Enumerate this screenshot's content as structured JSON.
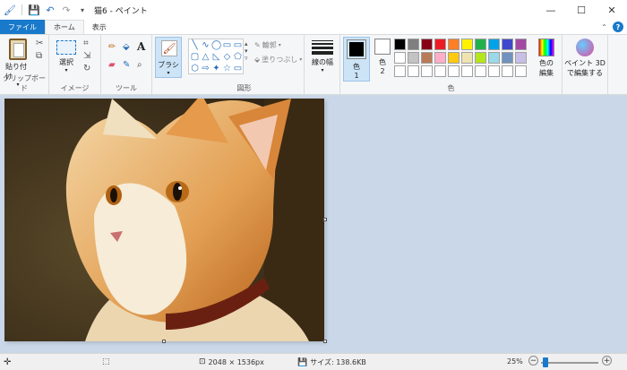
{
  "window": {
    "title": "猫6 - ペイント",
    "minimize_glyph": "—",
    "maximize_glyph": "☐",
    "close_glyph": "✕"
  },
  "menu": {
    "file": "ファイル",
    "home": "ホーム",
    "view": "表示",
    "help_glyph": "?"
  },
  "ribbon": {
    "clipboard": {
      "paste_label": "貼り付け",
      "group_label": "クリップボード"
    },
    "image": {
      "select_label": "選択",
      "group_label": "イメージ"
    },
    "tools": {
      "group_label": "ツール"
    },
    "brushes": {
      "label": "ブラシ"
    },
    "shapes": {
      "outline_label": "輪郭",
      "fill_label": "塗りつぶし",
      "group_label": "図形",
      "glyphs": [
        "╲",
        "∿",
        "◯",
        "▭",
        "▭",
        "▢",
        "△",
        "◺",
        "◇",
        "⬠",
        "⬡",
        "⇨",
        "✦",
        "☆",
        "▭"
      ]
    },
    "size": {
      "label": "線の幅"
    },
    "colors": {
      "color1_label": "色",
      "color1_num": "1",
      "color2_label": "色",
      "color2_num": "2",
      "color1_value": "#000000",
      "color2_value": "#ffffff",
      "group_label": "色",
      "palette": [
        "#000000",
        "#7f7f7f",
        "#880015",
        "#ed1c24",
        "#ff7f27",
        "#fff200",
        "#22b14c",
        "#00a2e8",
        "#3f48cc",
        "#a349a4",
        "#ffffff",
        "#c3c3c3",
        "#b97a57",
        "#ffaec9",
        "#ffc90e",
        "#efe4b0",
        "#b5e61d",
        "#99d9ea",
        "#7092be",
        "#c8bfe7",
        "#ffffff",
        "#ffffff",
        "#ffffff",
        "#ffffff",
        "#ffffff",
        "#ffffff",
        "#ffffff",
        "#ffffff",
        "#ffffff",
        "#ffffff"
      ],
      "edit_label_1": "色の",
      "edit_label_2": "編集"
    },
    "paint3d": {
      "label_1": "ペイント 3D",
      "label_2": "で編集する"
    }
  },
  "status": {
    "dimensions": "2048 × 1536px",
    "size": "サイズ: 138.6KB",
    "zoom": "25%",
    "zoom_out_glyph": "−",
    "zoom_in_glyph": "+"
  }
}
